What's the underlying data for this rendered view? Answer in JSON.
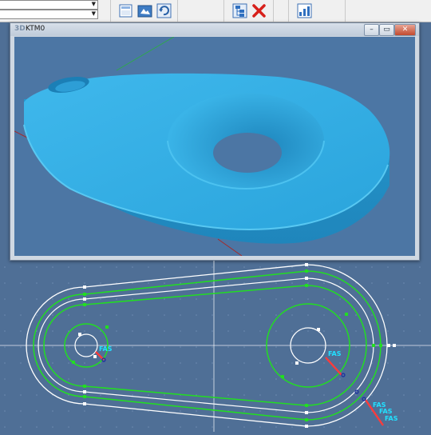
{
  "toolbar": {
    "combo_1_value": "",
    "combo_2_value": "",
    "buttons": [
      {
        "icon": "document-icon",
        "action": "new"
      },
      {
        "icon": "open-folder-icon",
        "action": "open"
      },
      {
        "icon": "refresh-icon",
        "action": "refresh"
      },
      {
        "icon": "tree-icon",
        "action": "hierarchy"
      },
      {
        "icon": "delete-x-icon",
        "action": "delete"
      },
      {
        "icon": "chart-icon",
        "action": "chart"
      }
    ]
  },
  "view_window": {
    "badge": "3D",
    "title": "KTM0",
    "controls": {
      "minimize": "–",
      "restore": "▭",
      "close": "✕"
    }
  },
  "drawing": {
    "labels": [
      "FAS",
      "FAS",
      "FAS",
      "FAS",
      "FAS"
    ]
  },
  "colors": {
    "background": "#4f6f96",
    "part": "#2aa8e0",
    "profile_green": "#22dd22",
    "profile_white": "#ffffff",
    "label_cyan": "#22e0ff",
    "arrow_red": "#ff3b3b",
    "axis_red": "#9a2a2a"
  }
}
